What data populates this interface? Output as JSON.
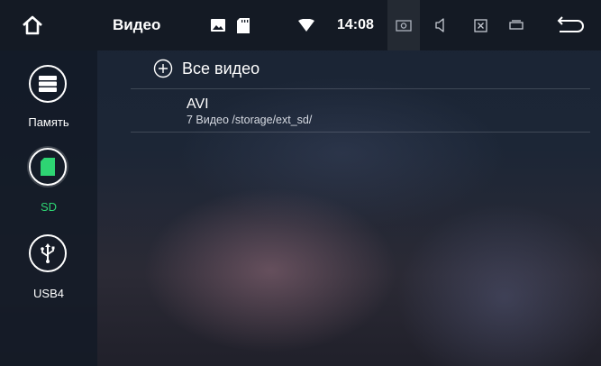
{
  "status_bar": {
    "title": "Видео",
    "clock": "14:08"
  },
  "sources": [
    {
      "label": "Память",
      "active": false
    },
    {
      "label": "SD",
      "active": true
    },
    {
      "label": "USB4",
      "active": false
    }
  ],
  "list": {
    "all_videos_label": "Все видео",
    "folders": [
      {
        "name": "AVI",
        "info": "7 Видео /storage/ext_sd/"
      }
    ]
  },
  "colors": {
    "active_source": "#2ed573",
    "statusbar_bg": "#141a24"
  }
}
